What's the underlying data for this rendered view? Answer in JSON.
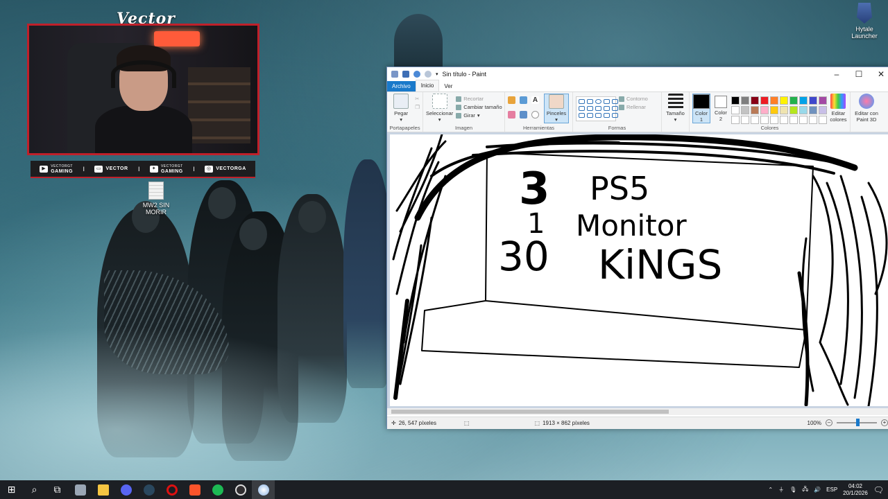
{
  "overlay": {
    "streamer_name": "Vector",
    "socials": [
      {
        "icon": "youtube-icon",
        "small": "VECTORGT",
        "label": "GAMING"
      },
      {
        "icon": "twitch-icon",
        "small": "",
        "label": "VECTOR"
      },
      {
        "icon": "twitter-icon",
        "small": "VECTORGT",
        "label": "GAMING"
      },
      {
        "icon": "instagram-icon",
        "small": "",
        "label": "VECTORGA"
      }
    ],
    "separator": "I"
  },
  "desktop": {
    "icons": [
      {
        "label": "MW2 SIN MORIR",
        "icon": "document-icon"
      },
      {
        "label": "Hytale Launcher",
        "icon": "hytale-icon"
      }
    ]
  },
  "paint": {
    "title": "Sin título - Paint",
    "tabs": {
      "file": "Archivo",
      "home": "Inicio",
      "view": "Ver"
    },
    "clipboard": {
      "paste": "Pegar",
      "label": "Portapapeles"
    },
    "image": {
      "select": "Seleccionar",
      "crop": "Recortar",
      "resize": "Cambiar tamaño",
      "rotate": "Girar",
      "label": "Imagen"
    },
    "tools": {
      "label": "Herramientas",
      "brushes": "Pinceles"
    },
    "shapes": {
      "outline": "Contorno",
      "fill": "Rellenar",
      "label": "Formas"
    },
    "size": {
      "label": "Tamaño"
    },
    "colors": {
      "color1": "Color",
      "color1_num": "1",
      "color2": "Color",
      "color2_num": "2",
      "edit": "Editar",
      "edit2": "colores",
      "label": "Colores",
      "palette": [
        "#000000",
        "#7f7f7f",
        "#880015",
        "#ed1c24",
        "#ff7f27",
        "#fff200",
        "#22b14c",
        "#00a2e8",
        "#3f48cc",
        "#a349a4",
        "#ffffff",
        "#c3c3c3",
        "#b97a57",
        "#ffaec9",
        "#ffc90e",
        "#efe4b0",
        "#b5e61d",
        "#99d9ea",
        "#7092be",
        "#c8bfe7",
        "#ffffff",
        "#ffffff",
        "#ffffff",
        "#ffffff",
        "#ffffff",
        "#ffffff",
        "#ffffff",
        "#ffffff",
        "#ffffff",
        "#ffffff"
      ]
    },
    "paint3d": {
      "line1": "Editar con",
      "line2": "Paint 3D"
    },
    "drawing": {
      "line1_a": "3",
      "line1_b": "PS5",
      "line2_a": "1",
      "line2_b": "Monitor",
      "line3_a": "30",
      "line3_b": "KiNGS"
    },
    "status": {
      "cursor": "26, 547 píxeles",
      "dimensions": "1913 × 862 píxeles",
      "zoom": "100%"
    }
  },
  "taskbar": {
    "lang": "ESP",
    "time": "04:02",
    "date": "20/1/2026"
  }
}
